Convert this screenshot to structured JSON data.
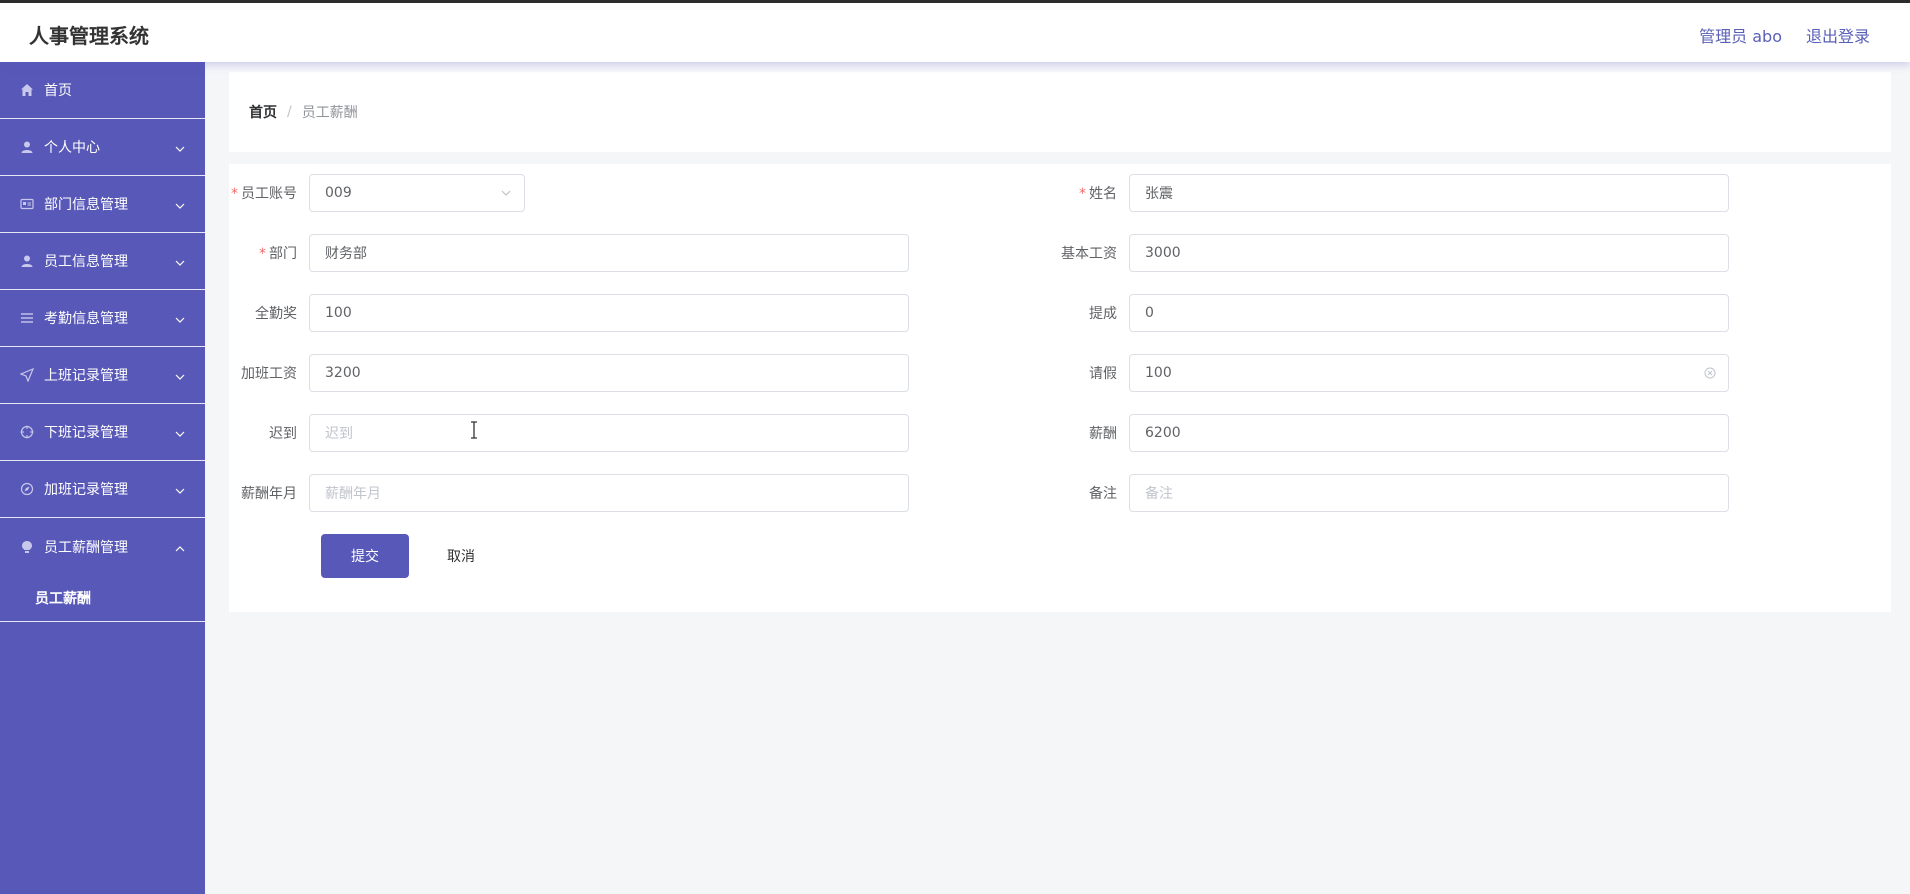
{
  "header": {
    "app_title": "人事管理系统",
    "admin_label": "管理员 abo",
    "logout_label": "退出登录"
  },
  "sidebar": {
    "items": [
      {
        "label": "首页",
        "icon": "home-icon"
      },
      {
        "label": "个人中心",
        "icon": "user-icon"
      },
      {
        "label": "部门信息管理",
        "icon": "card-icon"
      },
      {
        "label": "员工信息管理",
        "icon": "user-icon"
      },
      {
        "label": "考勤信息管理",
        "icon": "list-icon"
      },
      {
        "label": "上班记录管理",
        "icon": "send-icon"
      },
      {
        "label": "下班记录管理",
        "icon": "crosshair-icon"
      },
      {
        "label": "加班记录管理",
        "icon": "compass-icon"
      },
      {
        "label": "员工薪酬管理",
        "icon": "bulb-icon"
      }
    ],
    "submenu": {
      "label": "员工薪酬"
    }
  },
  "breadcrumb": {
    "home": "首页",
    "separator": "/",
    "current": "员工薪酬"
  },
  "form": {
    "employee_account": {
      "label": "员工账号",
      "value": "009"
    },
    "name": {
      "label": "姓名",
      "value": "张震"
    },
    "department": {
      "label": "部门",
      "value": "财务部"
    },
    "base_salary": {
      "label": "基本工资",
      "value": "3000"
    },
    "attendance_bonus": {
      "label": "全勤奖",
      "value": "100"
    },
    "commission": {
      "label": "提成",
      "value": "0"
    },
    "overtime_pay": {
      "label": "加班工资",
      "value": "3200"
    },
    "leave": {
      "label": "请假",
      "value": "100"
    },
    "late": {
      "label": "迟到",
      "placeholder": "迟到"
    },
    "salary": {
      "label": "薪酬",
      "value": "6200"
    },
    "salary_month": {
      "label": "薪酬年月",
      "placeholder": "薪酬年月"
    },
    "remark": {
      "label": "备注",
      "placeholder": "备注"
    },
    "submit_label": "提交",
    "cancel_label": "取消"
  },
  "colors": {
    "accent": "#5858b8",
    "required": "#f56c6c"
  }
}
